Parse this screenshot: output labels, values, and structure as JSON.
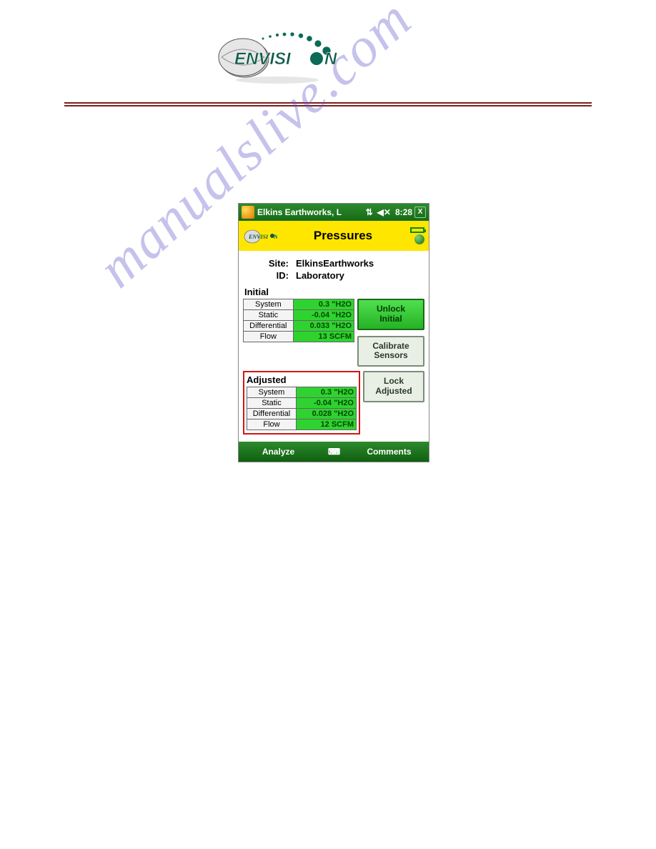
{
  "watermark": "manualslive.com",
  "device": {
    "titlebar": {
      "title": "Elkins Earthworks, L",
      "time": "8:28",
      "close": "X"
    },
    "yellowbar": {
      "title": "Pressures"
    },
    "site_label": "Site:",
    "site_value": "ElkinsEarthworks",
    "id_label": "ID:",
    "id_value": "Laboratory",
    "initial": {
      "heading": "Initial",
      "rows": [
        {
          "label": "System",
          "value": "0.3  \"H2O"
        },
        {
          "label": "Static",
          "value": "-0.04 \"H2O"
        },
        {
          "label": "Differential",
          "value": "0.033 \"H2O"
        },
        {
          "label": "Flow",
          "value": "13 SCFM"
        }
      ]
    },
    "adjusted": {
      "heading": "Adjusted",
      "rows": [
        {
          "label": "System",
          "value": "0.3  \"H2O"
        },
        {
          "label": "Static",
          "value": "-0.04 \"H2O"
        },
        {
          "label": "Differential",
          "value": "0.028 \"H2O"
        },
        {
          "label": "Flow",
          "value": "12 SCFM"
        }
      ]
    },
    "buttons": {
      "unlock_initial": "Unlock\nInitial",
      "calibrate_sensors": "Calibrate\nSensors",
      "lock_adjusted": "Lock\nAdjusted"
    },
    "bottombar": {
      "analyze": "Analyze",
      "comments": "Comments"
    }
  }
}
